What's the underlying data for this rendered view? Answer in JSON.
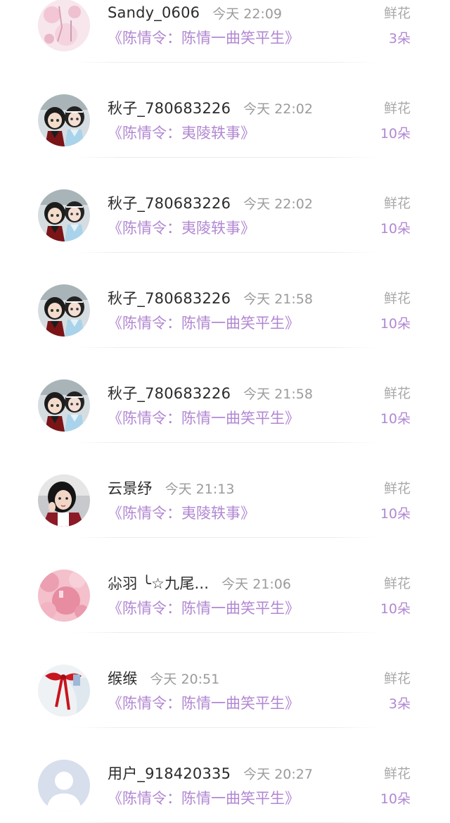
{
  "gift_list": [
    {
      "avatar": "pink-floral-avatar",
      "username": "Sandy_0606",
      "time": "今天 22:09",
      "work": "《陈情令：陈情一曲笑平生》",
      "gift_label": "鲜花",
      "gift_count": "3朵"
    },
    {
      "avatar": "figurine-avatar",
      "username": "秋子_780683226",
      "time": "今天 22:02",
      "work": "《陈情令：夷陵轶事》",
      "gift_label": "鲜花",
      "gift_count": "10朵"
    },
    {
      "avatar": "figurine-avatar",
      "username": "秋子_780683226",
      "time": "今天 22:02",
      "work": "《陈情令：夷陵轶事》",
      "gift_label": "鲜花",
      "gift_count": "10朵"
    },
    {
      "avatar": "figurine-avatar",
      "username": "秋子_780683226",
      "time": "今天 21:58",
      "work": "《陈情令：陈情一曲笑平生》",
      "gift_label": "鲜花",
      "gift_count": "10朵"
    },
    {
      "avatar": "figurine-avatar",
      "username": "秋子_780683226",
      "time": "今天 21:58",
      "work": "《陈情令：陈情一曲笑平生》",
      "gift_label": "鲜花",
      "gift_count": "10朵"
    },
    {
      "avatar": "girl-photo-avatar",
      "username": "云景纾",
      "time": "今天 21:13",
      "work": "《陈情令：夷陵轶事》",
      "gift_label": "鲜花",
      "gift_count": "10朵"
    },
    {
      "avatar": "pink-blossom-avatar",
      "username": "尛羽 ╰☆九尾...",
      "time": "今天 21:06",
      "work": "《陈情令：陈情一曲笑平生》",
      "gift_label": "鲜花",
      "gift_count": "10朵"
    },
    {
      "avatar": "red-ribbon-avatar",
      "username": "缑缑",
      "time": "今天 20:51",
      "work": "《陈情令：陈情一曲笑平生》",
      "gift_label": "鲜花",
      "gift_count": "3朵"
    },
    {
      "avatar": "default-user-avatar",
      "username": "用户_918420335",
      "time": "今天 20:27",
      "work": "《陈情令：陈情一曲笑平生》",
      "gift_label": "鲜花",
      "gift_count": "10朵"
    }
  ],
  "colors": {
    "accent": "#b187d2",
    "username": "#2b2b2b",
    "muted": "#9b9b9b"
  }
}
